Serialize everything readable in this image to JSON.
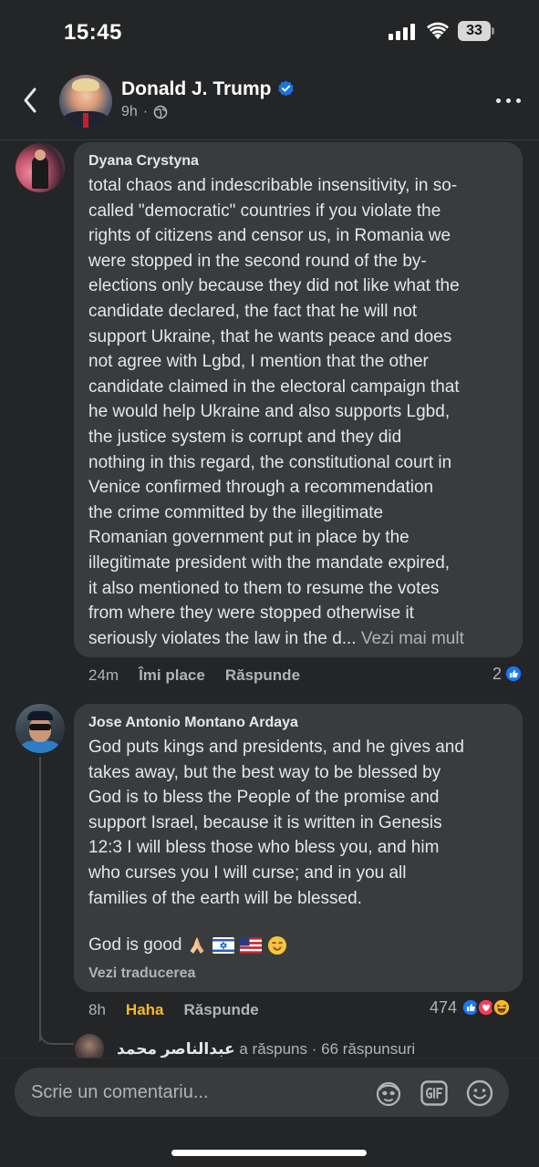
{
  "status_bar": {
    "time": "15:45",
    "battery": "33"
  },
  "header": {
    "name": "Donald J. Trump",
    "time": "9h",
    "dot": "·"
  },
  "comments": [
    {
      "author": "Dyana Crystyna",
      "lines": [
        "total chaos and indescribable insensitivity, in so-",
        "called \"democratic\" countries if you violate the",
        "rights of citizens and censor us, in Romania we",
        "were stopped in the second round of the by-",
        "elections only because they did not like what the",
        "candidate declared, the fact that he will not",
        "support Ukraine, that he wants peace and does",
        "not agree with Lgbd, I mention that the other",
        "candidate claimed in the electoral campaign that",
        "he would help Ukraine and also supports Lgbd,",
        "the justice system is corrupt and they did",
        "nothing in this regard, the constitutional court in",
        "Venice confirmed through a recommendation",
        "the crime committed by the illegitimate",
        "Romanian government put in place by the",
        "illegitimate president with the mandate expired,",
        "it also mentioned to them to resume the votes",
        "from where they were stopped otherwise it"
      ],
      "last_line": "seriously violates the law in the d...",
      "see_more": "Vezi mai mult",
      "time": "24m",
      "like_label": "Îmi place",
      "reply_label": "Răspunde",
      "reaction_count": "2"
    },
    {
      "author": "Jose Antonio Montano Ardaya",
      "lines": [
        "God puts kings and presidents, and he gives and",
        "takes away, but the best way to be blessed by",
        "God is to bless the People of the promise and",
        "support Israel, because it is written in Genesis",
        "12:3 I will bless those who bless you, and him",
        "who curses you I will curse; and in you all",
        "families of the earth will be blessed."
      ],
      "closing": "God is good",
      "translate_label": "Vezi traducerea",
      "time": "8h",
      "reaction_label": "Haha",
      "reply_label": "Răspunde",
      "reaction_count": "474"
    }
  ],
  "reply_summary": {
    "name": "عبدالناصر محمد",
    "text": "a răspuns · 66 răspunsuri"
  },
  "composer": {
    "placeholder": "Scrie un comentariu..."
  },
  "colors": {
    "background": "#242526",
    "bubble": "#3a3b3c",
    "like_blue": "#1877f2",
    "haha_yellow": "#f7b928",
    "love_red": "#f33e58"
  }
}
